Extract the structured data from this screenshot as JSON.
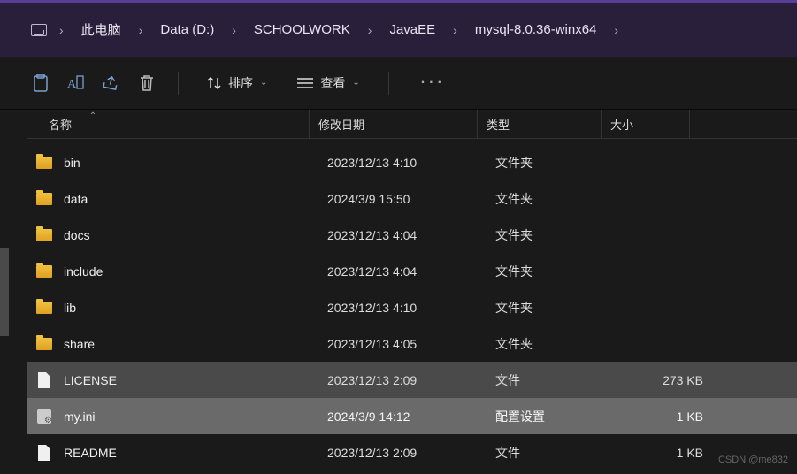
{
  "breadcrumb": [
    {
      "label": "此电脑"
    },
    {
      "label": "Data (D:)"
    },
    {
      "label": "SCHOOLWORK"
    },
    {
      "label": "JavaEE"
    },
    {
      "label": "mysql-8.0.36-winx64"
    }
  ],
  "toolbar": {
    "sort_label": "排序",
    "view_label": "查看"
  },
  "columns": {
    "name": "名称",
    "modified": "修改日期",
    "type": "类型",
    "size": "大小"
  },
  "rows": [
    {
      "icon": "folder",
      "name": "bin",
      "date": "2023/12/13 4:10",
      "type": "文件夹",
      "size": ""
    },
    {
      "icon": "folder",
      "name": "data",
      "date": "2024/3/9 15:50",
      "type": "文件夹",
      "size": ""
    },
    {
      "icon": "folder",
      "name": "docs",
      "date": "2023/12/13 4:04",
      "type": "文件夹",
      "size": ""
    },
    {
      "icon": "folder",
      "name": "include",
      "date": "2023/12/13 4:04",
      "type": "文件夹",
      "size": ""
    },
    {
      "icon": "folder",
      "name": "lib",
      "date": "2023/12/13 4:10",
      "type": "文件夹",
      "size": ""
    },
    {
      "icon": "folder",
      "name": "share",
      "date": "2023/12/13 4:05",
      "type": "文件夹",
      "size": ""
    },
    {
      "icon": "file",
      "name": "LICENSE",
      "date": "2023/12/13 2:09",
      "type": "文件",
      "size": "273 KB",
      "sel": 1
    },
    {
      "icon": "ini",
      "name": "my.ini",
      "date": "2024/3/9 14:12",
      "type": "配置设置",
      "size": "1 KB",
      "sel": 2
    },
    {
      "icon": "file",
      "name": "README",
      "date": "2023/12/13 2:09",
      "type": "文件",
      "size": "1 KB"
    }
  ],
  "watermark": "CSDN @me832"
}
